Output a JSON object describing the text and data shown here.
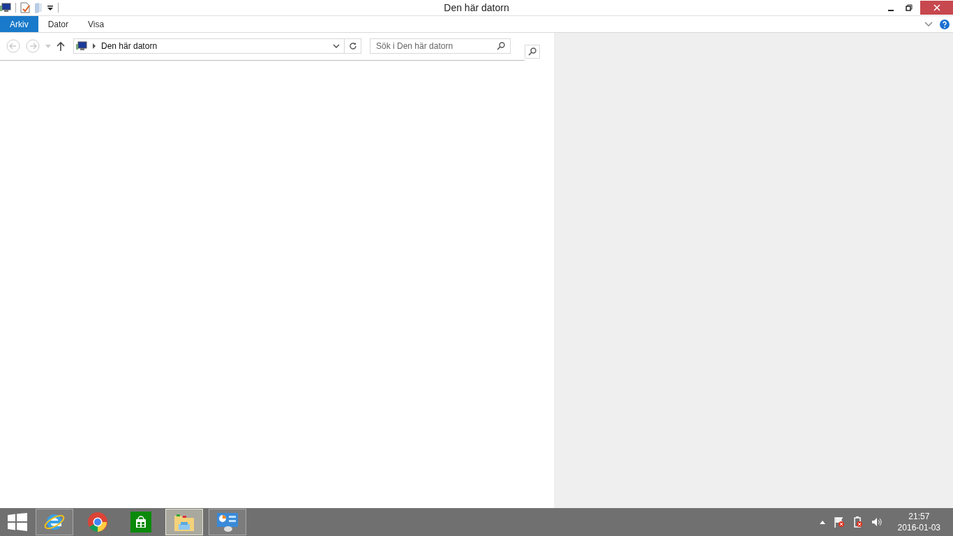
{
  "window": {
    "title": "Den här datorn"
  },
  "tabs": [
    {
      "label": "Arkiv",
      "selected": true
    },
    {
      "label": "Dator",
      "selected": false
    },
    {
      "label": "Visa",
      "selected": false
    }
  ],
  "address_bar": {
    "path": "Den här datorn"
  },
  "search": {
    "placeholder": "Sök i Den här datorn"
  },
  "taskbar": {
    "apps": [
      {
        "kind": "ie",
        "running": true,
        "selected": false
      },
      {
        "kind": "chrome",
        "running": false,
        "selected": false
      },
      {
        "kind": "store",
        "running": false,
        "selected": false
      },
      {
        "kind": "explorer",
        "running": true,
        "selected": true
      },
      {
        "kind": "control",
        "running": true,
        "selected": false
      }
    ],
    "clock": {
      "time": "21:57",
      "date": "2016-01-03"
    }
  }
}
